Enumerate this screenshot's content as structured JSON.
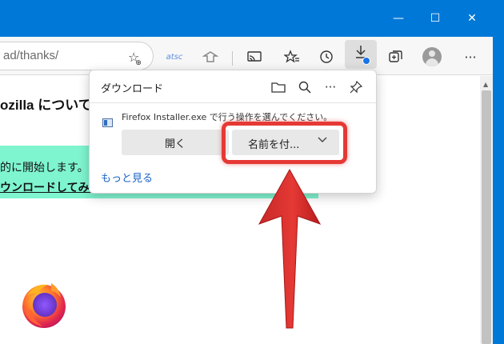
{
  "window": {
    "minimize_glyph": "—",
    "maximize_glyph": "☐",
    "close_glyph": "✕"
  },
  "address_bar": {
    "url": "ad/thanks/"
  },
  "toolbar": {
    "ext1_label": "atsc",
    "icons": [
      "add-favorite-icon",
      "extension-icon",
      "extension-icon",
      "cast-icon",
      "favorites-icon",
      "history-icon",
      "downloads-icon",
      "collections-icon",
      "profile-avatar",
      "more-menu-icon"
    ]
  },
  "page": {
    "heading": "ozilla について",
    "notice_line1": "的に開始します。",
    "notice_line2": "ウンロードしてみて"
  },
  "download_panel": {
    "title": "ダウンロード",
    "file_message": "Firefox Installer.exe で行う操作を選んでください。",
    "open_label": "開く",
    "save_as_label": "名前を付...",
    "more_label": "もっと見る"
  },
  "colors": {
    "titlebar": "#0078d7",
    "notice_bg": "#7ff5cf",
    "highlight": "#e53935",
    "link": "#1a64c8"
  }
}
